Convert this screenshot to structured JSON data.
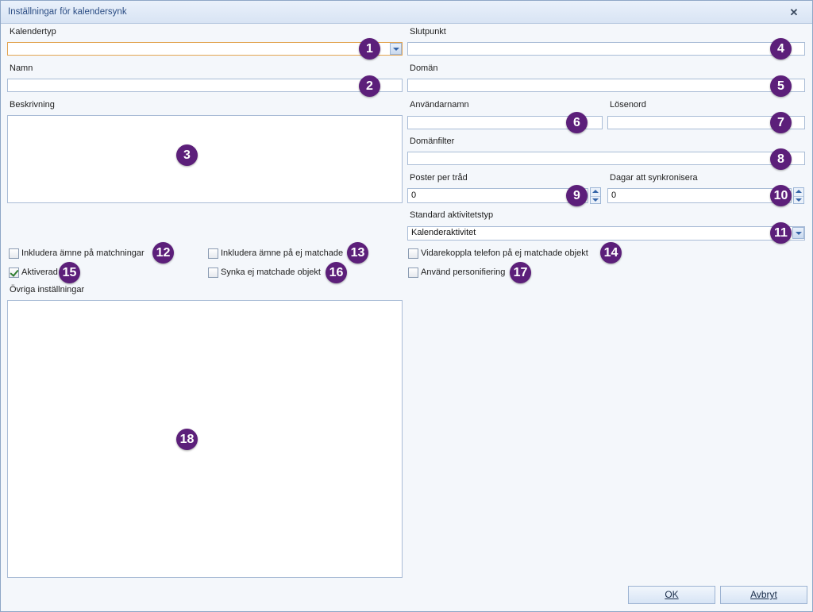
{
  "window": {
    "title": "Inställningar för kalendersynk",
    "close_icon": "close-icon"
  },
  "labels": {
    "kalendertyp": "Kalendertyp",
    "namn": "Namn",
    "beskrivning": "Beskrivning",
    "slutpunkt": "Slutpunkt",
    "doman": "Domän",
    "anvandarnamn": "Användarnamn",
    "losenord": "Lösenord",
    "domanfilter": "Domänfilter",
    "poster_per_trad": "Poster per tråd",
    "dagar_att_synkronisera": "Dagar att synkronisera",
    "standard_aktivitetstyp": "Standard aktivitetstyp",
    "ovriga_installningar": "Övriga inställningar"
  },
  "values": {
    "kalendertyp": "",
    "namn": "",
    "slutpunkt": "",
    "doman": "",
    "anvandarnamn": "",
    "losenord": "",
    "domanfilter": "",
    "poster_per_trad": "0",
    "dagar_att_synkronisera": "0",
    "standard_aktivitetstyp": "Kalenderaktivitet"
  },
  "checkboxes": {
    "inkludera_amne_matchningar": {
      "label": "Inkludera ämne på matchningar",
      "checked": false
    },
    "inkludera_amne_ej_matchade": {
      "label": "Inkludera ämne på ej matchade",
      "checked": false
    },
    "vidarekoppla_telefon": {
      "label": "Vidarekoppla telefon på ej matchade objekt",
      "checked": false
    },
    "aktiverad": {
      "label": "Aktiverad",
      "checked": true
    },
    "synka_ej_matchade": {
      "label": "Synka ej matchade objekt",
      "checked": false
    },
    "anvand_personifiering": {
      "label": "Använd personifiering",
      "checked": false
    }
  },
  "badges": [
    "1",
    "2",
    "3",
    "4",
    "5",
    "6",
    "7",
    "8",
    "9",
    "10",
    "11",
    "12",
    "13",
    "14",
    "15",
    "16",
    "17",
    "18"
  ],
  "buttons": {
    "ok": "OK",
    "avbryt": "Avbryt"
  },
  "colors": {
    "badge": "#5c1f7a",
    "title_text": "#2a4c83",
    "field_border": "#a9bcd6"
  }
}
